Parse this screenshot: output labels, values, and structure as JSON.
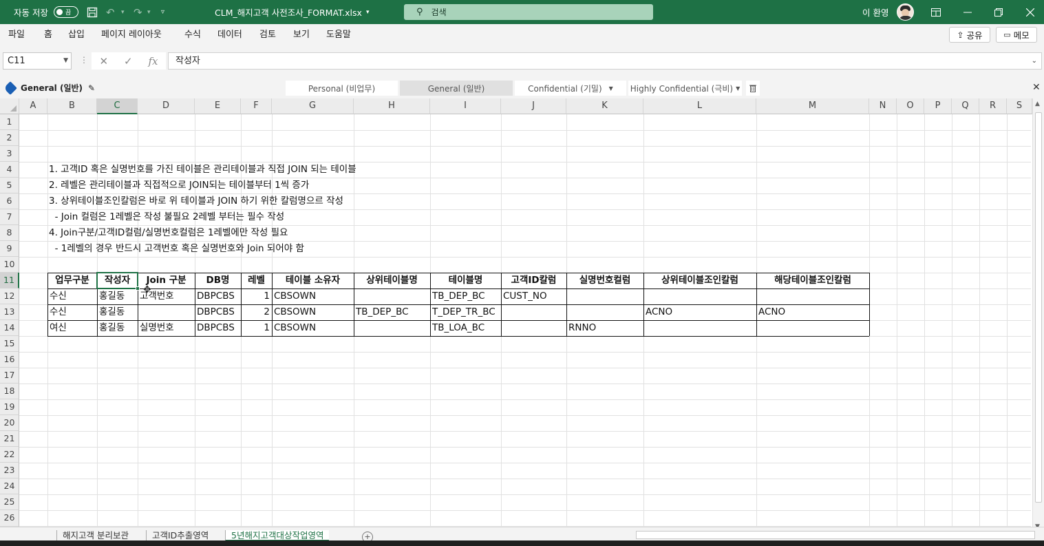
{
  "titlebar": {
    "autosave_label": "자동 저장",
    "autosave_state": "끔",
    "filename": "CLM_해지고객 사전조사_FORMAT.xlsx",
    "search_placeholder": "검색",
    "user_name": "이 환영"
  },
  "menu": [
    "파일",
    "홈",
    "삽입",
    "페이지 레이아웃",
    "수식",
    "데이터",
    "검토",
    "보기",
    "도움말"
  ],
  "share_label": "공유",
  "memo_label": "메모",
  "formula": {
    "name_box": "C11",
    "content": "작성자",
    "fx": "fx"
  },
  "sensitivity": {
    "current": "General (일반)",
    "options": [
      "Personal (비업무)",
      "General (일반)",
      "Confidential (기밀)",
      "Highly Confidential (극비)"
    ]
  },
  "columns": [
    "A",
    "B",
    "C",
    "D",
    "E",
    "F",
    "G",
    "H",
    "I",
    "J",
    "K",
    "L",
    "M",
    "N",
    "O",
    "P",
    "Q",
    "R",
    "S"
  ],
  "rows": [
    "1",
    "2",
    "3",
    "4",
    "5",
    "6",
    "7",
    "8",
    "9",
    "10",
    "11",
    "12",
    "13",
    "14",
    "15",
    "16",
    "17",
    "18",
    "19",
    "20",
    "21",
    "22",
    "23",
    "24",
    "25",
    "26"
  ],
  "notes": [
    "1. 고객ID 혹은 실명번호를 가진 테이블은 관리테이블과 직접 JOIN 되는 테이블",
    "2. 레벨은 관리테이블과 직접적으로 JOIN되는 테이블부터 1씩 증가",
    "3. 상위테이블조인칼럼은 바로 위 테이블과 JOIN 하기 위한 칼럼명으르 작성",
    "  - Join 컬럼은 1레벨은 작성 불필요 2레벨 부터는 필수 작성",
    "4. Join구분/고객ID컬럼/실명번호컬럼은 1레벨에만 작성 필요",
    "  - 1레벨의 경우 반드시 고객번호 혹은 실명번호와 Join 되어야 함"
  ],
  "table": {
    "headers": [
      "업무구분",
      "작성자",
      "Join 구분",
      "DB명",
      "레벨",
      "테이블 소유자",
      "상위테이블명",
      "테이블명",
      "고객ID칼럼",
      "실명번호컬럼",
      "상위테이블조인칼럼",
      "해당테이블조인칼럼"
    ],
    "rows": [
      [
        "수신",
        "홍길동",
        "고객번호",
        "DBPCBS",
        "1",
        "CBSOWN",
        "",
        "TB_DEP_BC",
        "CUST_NO",
        "",
        "",
        ""
      ],
      [
        "수신",
        "홍길동",
        "",
        "DBPCBS",
        "2",
        "CBSOWN",
        "TB_DEP_BC",
        "T_DEP_TR_BC",
        "",
        "",
        "ACNO",
        "ACNO"
      ],
      [
        "여신",
        "홍길동",
        "실명번호",
        "DBPCBS",
        "1",
        "CBSOWN",
        "",
        "TB_LOA_BC",
        "",
        "RNNO",
        "",
        ""
      ]
    ]
  },
  "sheet_tabs": [
    "해지고객 분리보관",
    "고객ID추출영역",
    "5년해지고객대상작업영역"
  ],
  "colors": {
    "accent": "#1e7145",
    "search_bg": "#a8d3ba"
  }
}
